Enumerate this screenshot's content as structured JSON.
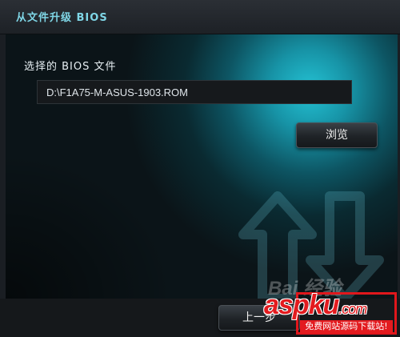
{
  "window": {
    "title": "从文件升级 BIOS"
  },
  "main": {
    "bios_file_label": "选择的 BIOS 文件",
    "bios_file_path": "D:\\F1A75-M-ASUS-1903.ROM",
    "browse_label": "浏览"
  },
  "footer": {
    "prev_label": "上一步"
  },
  "watermark": {
    "baidu": "Bai 经验",
    "brand": "aspku",
    "brand_suffix": ".com",
    "tagline": "免费网站源码下载站!"
  },
  "colors": {
    "accent_cyan": "#24c2d4",
    "title_text": "#7fd6e6",
    "watermark_red": "#e31b1f"
  },
  "icons": {
    "background_arrows": "swap-arrows-icon"
  }
}
